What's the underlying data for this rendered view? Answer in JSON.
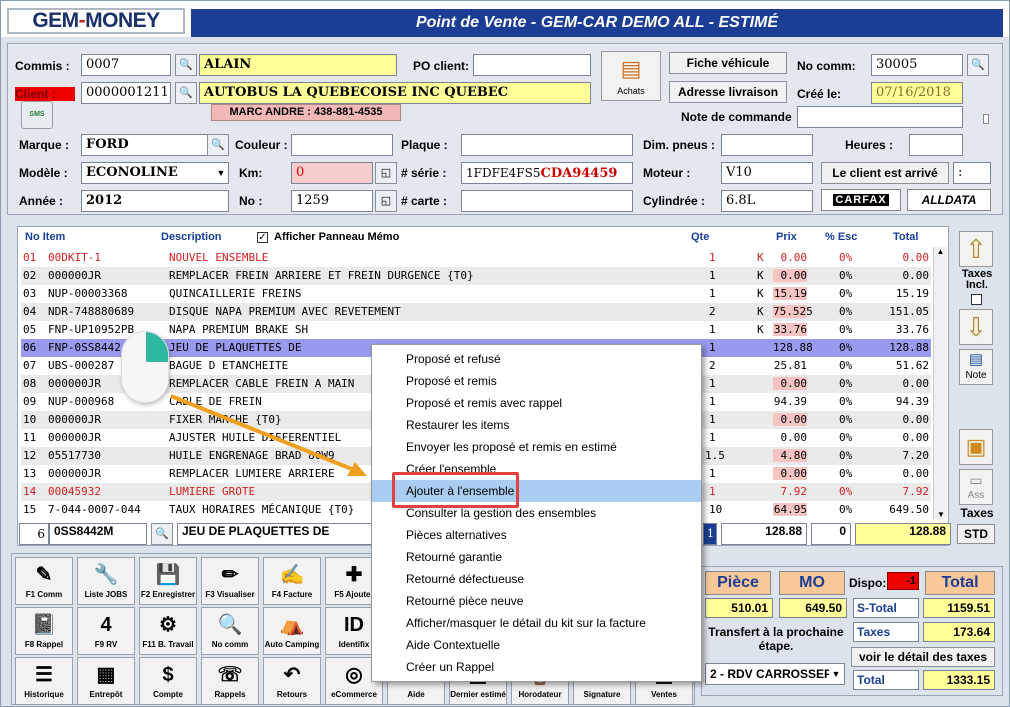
{
  "logo": {
    "gem": "GEM",
    "dash": "-",
    "money": "MONEY"
  },
  "title": "Point de Vente - GEM-CAR DEMO ALL  - ESTIMÉ",
  "form": {
    "commis_label": "Commis :",
    "commis_value": "0007",
    "commis_name": "ALAIN",
    "client_label": "Client :",
    "client_value": "0000001211",
    "client_name": "AUTOBUS LA QUEBECOISE INC QUEBEC",
    "contact": "MARC ANDRE : 438-881-4535",
    "sms": "SMS",
    "po_label": "PO client:",
    "po_value": "",
    "achats_label": "Achats",
    "fiche_btn": "Fiche véhicule",
    "adresse_btn": "Adresse livraison",
    "nocomm_label": "No comm:",
    "nocomm_value": "30005",
    "cree_label": "Créé le:",
    "cree_value": "07/16/2018",
    "note_label": "Note de commande",
    "marque_label": "Marque :",
    "marque_value": "FORD",
    "modele_label": "Modèle :",
    "modele_value": "ECONOLINE",
    "annee_label": "Année :",
    "annee_value": "2012",
    "couleur_label": "Couleur :",
    "km_label": "Km:",
    "km_value": "0",
    "no_label": "No :",
    "no_value": "1259",
    "plaque_label": "Plaque :",
    "serie_label": "# série :",
    "serie_value_a": "1FDFE4FS5",
    "serie_value_b": "CDA94459",
    "carte_label": "# carte :",
    "dimpneus_label": "Dim. pneus :",
    "moteur_label": "Moteur :",
    "moteur_value": "V10",
    "cylindree_label": "Cylindrée :",
    "cylindree_value": "6.8L",
    "heures_label": "Heures :",
    "arrive_btn": "Le client est arrivé",
    "arrive_small": ":",
    "carfax": "CARFAX",
    "alldata": "ALLDATA"
  },
  "grid": {
    "headers": {
      "item": "No Item",
      "desc": "Description",
      "memo": "Afficher Panneau Mémo",
      "qte": "Qte",
      "prix": "Prix",
      "esc": "% Esc",
      "total": "Total"
    },
    "rows": [
      {
        "n": "01",
        "item": "00DKIT-1",
        "desc": "NOUVEL ENSEMBLE",
        "qte": "1",
        "k": "K",
        "prix": "0.00",
        "esc": "0%",
        "total": "0.00",
        "red": true
      },
      {
        "n": "02",
        "item": "000000JR",
        "desc": "REMPLACER FREIN ARRIERE ET FREIN DURGENCE  {T0}",
        "qte": "1",
        "k": "K",
        "prix": "0.00",
        "esc": "0%",
        "total": "0.00",
        "red": false
      },
      {
        "n": "03",
        "item": "NUP-00003368",
        "desc": "QUINCAILLERIE FREINS",
        "qte": "1",
        "k": "K",
        "prix": "15.19",
        "esc": "0%",
        "total": "15.19",
        "red": false
      },
      {
        "n": "04",
        "item": "NDR-748880689",
        "desc": "DISQUE NAPA PREMIUM AVEC REVETEMENT",
        "qte": "2",
        "k": "K",
        "prix": "75.525",
        "esc": "0%",
        "total": "151.05",
        "red": false
      },
      {
        "n": "05",
        "item": "FNP-UP10952PB",
        "desc": "NAPA PREMIUM BRAKE SH",
        "qte": "1",
        "k": "K",
        "prix": "33.76",
        "esc": "0%",
        "total": "33.76",
        "red": false
      },
      {
        "n": "06",
        "item": "FNP-0SS8442",
        "desc": "JEU DE PLAQUETTES DE",
        "qte": "1",
        "k": "",
        "prix": "128.88",
        "esc": "0%",
        "total": "128.88",
        "red": false
      },
      {
        "n": "07",
        "item": "UBS-000287",
        "desc": "BAGUE D ETANCHEITE",
        "qte": "2",
        "k": "",
        "prix": "25.81",
        "esc": "0%",
        "total": "51.62",
        "red": false
      },
      {
        "n": "08",
        "item": "000000JR",
        "desc": "REMPLACER CABLE FREIN A MAIN",
        "qte": "1",
        "k": "",
        "prix": "0.00",
        "esc": "0%",
        "total": "0.00",
        "red": false
      },
      {
        "n": "09",
        "item": "NUP-000968",
        "desc": "CABLE DE FREIN",
        "qte": "1",
        "k": "",
        "prix": "94.39",
        "esc": "0%",
        "total": "94.39",
        "red": false
      },
      {
        "n": "10",
        "item": "000000JR",
        "desc": "FIXER MARCHE {T0}",
        "qte": "1",
        "k": "",
        "prix": "0.00",
        "esc": "0%",
        "total": "0.00",
        "red": false
      },
      {
        "n": "11",
        "item": "000000JR",
        "desc": "AJUSTER HUILE DIFFERENTIEL",
        "qte": "1",
        "k": "",
        "prix": "0.00",
        "esc": "0%",
        "total": "0.00",
        "red": false
      },
      {
        "n": "12",
        "item": "05517730",
        "desc": "HUILE ENGRENAGE BRAD 80W9",
        "qte": "1.5",
        "k": "",
        "prix": "4.80",
        "esc": "0%",
        "total": "7.20",
        "red": false
      },
      {
        "n": "13",
        "item": "000000JR",
        "desc": "REMPLACER LUMIERE ARRIERE",
        "qte": "1",
        "k": "",
        "prix": "0.00",
        "esc": "0%",
        "total": "0.00",
        "red": false
      },
      {
        "n": "14",
        "item": "00045932",
        "desc": "LUMIERE GROTE",
        "qte": "1",
        "k": "",
        "prix": "7.92",
        "esc": "0%",
        "total": "7.92",
        "red": true
      },
      {
        "n": "15",
        "item": "7-044-0007-044",
        "desc": "TAUX HORAIRES MÉCANIQUE {T0}",
        "qte": "10",
        "k": "",
        "prix": "64.95",
        "esc": "0%",
        "total": "649.50",
        "red": false
      }
    ],
    "edit": {
      "line": "6",
      "item": "0SS8442M",
      "desc": "JEU DE PLAQUETTES DE",
      "qte": "1",
      "prix": "128.88",
      "esc": "0",
      "total": "128.88"
    }
  },
  "side": {
    "taxes_incl": "Taxes Incl.",
    "note": "Note",
    "ass": "Ass",
    "taxes": "Taxes",
    "std": "STD"
  },
  "context_menu": [
    "Proposé et refusé",
    "Proposé et remis",
    "Proposé et remis avec rappel",
    "Restaurer les items",
    "Envoyer les proposé et remis en estimé",
    "Créer l'ensemble",
    "Ajouter à l'ensemble",
    "Consulter la gestion des ensembles",
    "Pièces alternatives",
    "Retourné garantie",
    "Retourné défectueuse",
    "Retourné pièce neuve",
    "Afficher/masquer le détail du kit sur la facture",
    "Aide Contextuelle",
    "Créer un Rappel"
  ],
  "toolbar": [
    {
      "label": "F1 Comm",
      "icon": "✎"
    },
    {
      "label": "Liste JOBS",
      "icon": "🔧"
    },
    {
      "label": "F2 Enregistrer",
      "icon": "💾"
    },
    {
      "label": "F3 Visualiser",
      "icon": "✏"
    },
    {
      "label": "F4 Facture",
      "icon": "✍"
    },
    {
      "label": "F5 Ajouter",
      "icon": "✚"
    },
    {
      "label": "F8 Rappel",
      "icon": "📓"
    },
    {
      "label": "F9 RV",
      "icon": "4"
    },
    {
      "label": "F11 B. Travail",
      "icon": "⚙"
    },
    {
      "label": "No comm",
      "icon": "🔍"
    },
    {
      "label": "Auto Camping",
      "icon": "⛺"
    },
    {
      "label": "Identifix",
      "icon": "ID"
    },
    {
      "label": "Historique",
      "icon": "☰"
    },
    {
      "label": "Entrepôt",
      "icon": "▦"
    },
    {
      "label": "Compte",
      "icon": "$"
    },
    {
      "label": "Rappels",
      "icon": "☏"
    },
    {
      "label": "Retours",
      "icon": "↶"
    },
    {
      "label": "eCommerce",
      "icon": "◎"
    },
    {
      "label": "Aide",
      "icon": "?"
    },
    {
      "label": "Dernier estimé",
      "icon": "▤"
    },
    {
      "label": "Horodateur",
      "icon": "⌚"
    },
    {
      "label": "Signature",
      "icon": "✒"
    },
    {
      "label": "Ventes",
      "icon": "▣"
    }
  ],
  "totals": {
    "piece_label": "Pièce",
    "mo_label": "MO",
    "dispo_label": "Dispo:",
    "dispo_value": "-1",
    "total_label": "Total",
    "piece_value": "510.01",
    "mo_value": "649.50",
    "stotal_label": "S-Total",
    "stotal_value": "1159.51",
    "taxes_label": "Taxes",
    "taxes_value": "173.64",
    "transfert": "Transfert à la prochaine étape.",
    "detail_taxes": "voir le détail des taxes",
    "rdv": "2 - RDV CARROSSEF",
    "total2_label": "Total",
    "total2_value": "1333.15"
  }
}
